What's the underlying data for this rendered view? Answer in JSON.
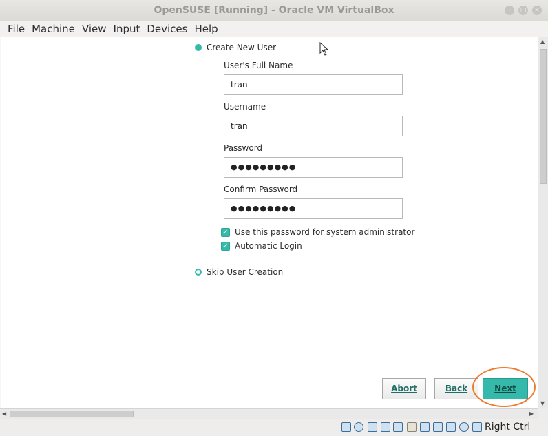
{
  "window": {
    "title": "OpenSUSE [Running] - Oracle VM VirtualBox"
  },
  "menu": [
    "File",
    "Machine",
    "View",
    "Input",
    "Devices",
    "Help"
  ],
  "form": {
    "create_user_option": "Create New User",
    "full_name_label": "User's Full Name",
    "full_name_value": "tran",
    "username_label": "Username",
    "username_value": "tran",
    "password_label": "Password",
    "password_value": "●●●●●●●●●",
    "confirm_label": "Confirm Password",
    "confirm_value": "●●●●●●●●●",
    "admin_checkbox_label": "Use this password for system administrator",
    "admin_checked": true,
    "autologin_label": "Automatic Login",
    "autologin_checked": true,
    "skip_option": "Skip User Creation"
  },
  "buttons": {
    "abort": "Abort",
    "back": "Back",
    "next": "Next"
  },
  "status": {
    "host_key": "Right Ctrl"
  },
  "colors": {
    "accent": "#35b9ab",
    "highlight_ring": "#ee7a2c"
  }
}
